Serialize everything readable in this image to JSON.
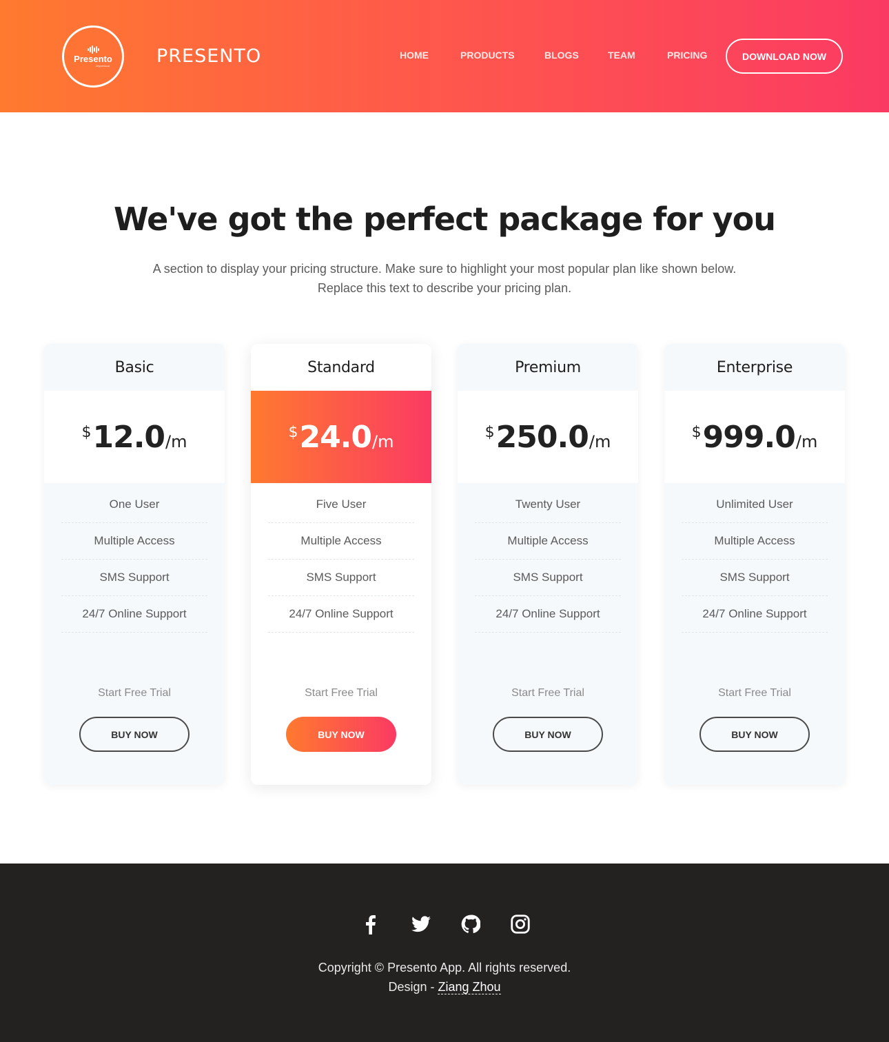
{
  "header": {
    "logo_text": "Presento",
    "logo_subtext": "#hyperlocal",
    "brand": "PRESENTO",
    "nav": [
      {
        "label": "HOME"
      },
      {
        "label": "PRODUCTS"
      },
      {
        "label": "BLOGS"
      },
      {
        "label": "TEAM"
      },
      {
        "label": "PRICING"
      }
    ],
    "cta_label": "DOWNLOAD NOW"
  },
  "intro": {
    "heading": "We've got the perfect package for you",
    "subtext_line1": "A section to display your pricing structure. Make sure to highlight your most popular plan like shown below.",
    "subtext_line2": "Replace this text to describe your pricing plan."
  },
  "plans": [
    {
      "name": "Basic",
      "currency": "$",
      "amount": "12.0",
      "period": "/m",
      "features": [
        "One User",
        "Multiple Access",
        "SMS Support",
        "24/7 Online Support"
      ],
      "trial": "Start Free Trial",
      "button": "BUY NOW",
      "featured": false
    },
    {
      "name": "Standard",
      "currency": "$",
      "amount": "24.0",
      "period": "/m",
      "features": [
        "Five User",
        "Multiple Access",
        "SMS Support",
        "24/7 Online Support"
      ],
      "trial": "Start Free Trial",
      "button": "BUY NOW",
      "featured": true
    },
    {
      "name": "Premium",
      "currency": "$",
      "amount": "250.0",
      "period": "/m",
      "features": [
        "Twenty User",
        "Multiple Access",
        "SMS Support",
        "24/7 Online Support"
      ],
      "trial": "Start Free Trial",
      "button": "BUY NOW",
      "featured": false
    },
    {
      "name": "Enterprise",
      "currency": "$",
      "amount": "999.0",
      "period": "/m",
      "features": [
        "Unlimited User",
        "Multiple Access",
        "SMS Support",
        "24/7 Online Support"
      ],
      "trial": "Start Free Trial",
      "button": "BUY NOW",
      "featured": false
    }
  ],
  "footer": {
    "social": [
      "facebook-icon",
      "twitter-icon",
      "github-icon",
      "instagram-icon"
    ],
    "copyright": "Copyright © Presento App. All rights reserved.",
    "design_prefix": "Design - ",
    "designer": "Ziang Zhou"
  },
  "colors": {
    "gradient_start": "#ff7a2f",
    "gradient_end": "#fb3a63",
    "footer_bg": "#232220",
    "card_bg": "#f5f9fb"
  }
}
